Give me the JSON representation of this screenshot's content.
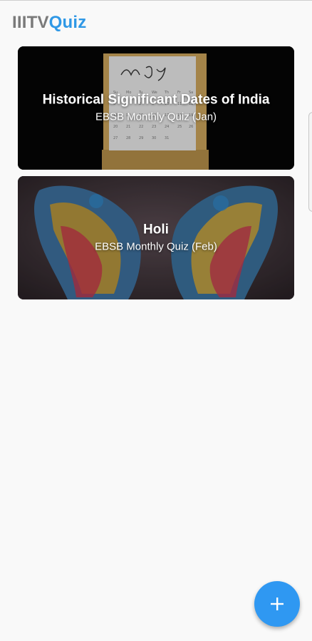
{
  "app": {
    "title_part_1": "IIITV",
    "title_part_2": "Quiz",
    "accent_color": "#2f98e6",
    "muted_color": "#7a7a7a"
  },
  "quizzes": [
    {
      "title": "Historical Significant Dates of India",
      "subtitle": "EBSB Monthly Quiz (Jan)",
      "image_icon": "calendar-may-icon"
    },
    {
      "title": "Holi",
      "subtitle": "EBSB Monthly Quiz (Feb)",
      "image_icon": "holi-color-hands-icon"
    }
  ],
  "fab": {
    "icon": "plus-icon",
    "color": "#2f98f2"
  }
}
